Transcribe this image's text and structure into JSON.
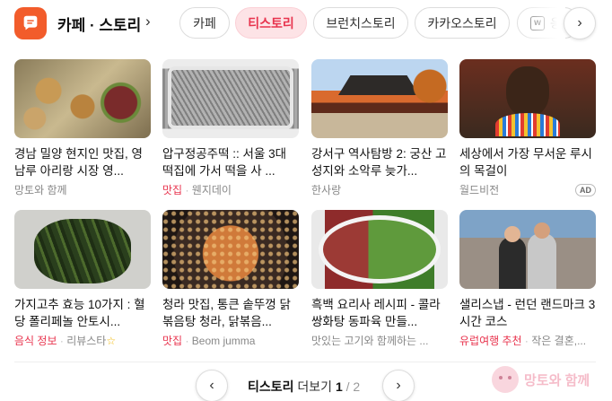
{
  "header": {
    "brand_title": "카페 · 스토리",
    "chevron": "›",
    "chips": [
      {
        "label": "카페"
      },
      {
        "label": "티스토리",
        "active": true
      },
      {
        "label": "브런치스토리"
      },
      {
        "label": "카카오스토리"
      },
      {
        "label": "응",
        "icon": "w-doc-icon"
      }
    ],
    "next_arrow": "›"
  },
  "cards": [
    {
      "title": "경남 밀양 현지인 맛집, 영남루 아리랑 시장 영...",
      "category": "",
      "source": "망토와 함께",
      "thumb": "korean-food-plates"
    },
    {
      "title": "압구정공주떡 :: 서울 3대 떡집에 가서 떡을 사 ...",
      "category": "맛집",
      "source": "웬지데이",
      "thumb": "rice-cake-box"
    },
    {
      "title": "강서구 역사탐방 2: 궁산 고성지와 소악루 늦가...",
      "category": "",
      "source": "한사랑",
      "thumb": "pavilion-autumn"
    },
    {
      "title": "세상에서 가장 무서운 루시의 목걸이",
      "category": "",
      "source": "월드비전",
      "ad": "AD",
      "thumb": "child-beads"
    },
    {
      "title": "가지고추 효능 10가지 : 혈당 폴리페놀 안토시...",
      "category": "음식 정보",
      "source": "리뷰스타",
      "thumb": "green-peppers"
    },
    {
      "title": "청라 맛집, 통큰 솥뚜껑 닭볶음탕 청라, 닭볶음...",
      "category": "맛집",
      "source": "Beom jumma",
      "thumb": "pan-dish"
    },
    {
      "title": "흑백 요리사 레시피 - 콜라 쌍화탕 동파육 만들...",
      "category": "",
      "source": "맛있는 고기와 함께하는 ...",
      "thumb": "pork-greens"
    },
    {
      "title": "샐리스냅 - 런던 랜드마크 3시간 코스",
      "category": "유럽여행 추천",
      "source": "작은 결혼,...",
      "thumb": "london-couple"
    }
  ],
  "pager": {
    "label": "티스토리",
    "suffix": "더보기",
    "current": "1",
    "separator": "/",
    "total": "2",
    "prev": "‹",
    "next": "›"
  },
  "watermark": {
    "text": "망토와 함께"
  },
  "colors": {
    "accent": "#e8344e",
    "brand": "#f25c2b",
    "active_chip_bg": "#fde3e6"
  }
}
